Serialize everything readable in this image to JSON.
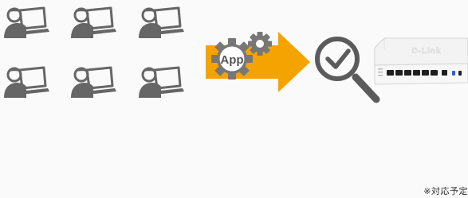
{
  "app_label": "App",
  "brand_label": "D-Link",
  "footnote": "※対応予定",
  "colors": {
    "background": "#fafafa",
    "icon_gray": "#666666",
    "arrow_orange": "#f5a300",
    "gear_gray": "#777777",
    "check_gray": "#5b5b5b",
    "device_white": "#f3f3f3",
    "port_black": "#1f1f1f"
  },
  "icons": {
    "users": "user-with-laptop-icon",
    "app": "app-gear-icon",
    "arrow": "right-arrow-icon",
    "inspect": "magnifier-check-icon",
    "device": "network-switch-icon"
  }
}
